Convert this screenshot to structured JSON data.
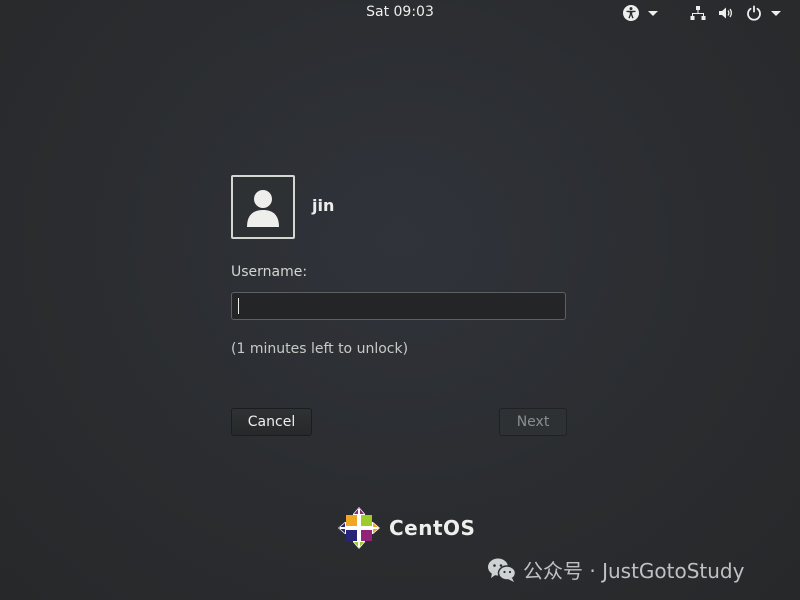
{
  "topbar": {
    "clock": "Sat 09:03",
    "icons": [
      "accessibility-icon",
      "network-icon",
      "volume-icon",
      "power-icon"
    ]
  },
  "login": {
    "user_name": "jin",
    "username_label": "Username:",
    "username_value": "",
    "lock_message": "(1 minutes left to unlock)",
    "cancel_label": "Cancel",
    "next_label": "Next"
  },
  "branding": {
    "logo_text": "CentOS"
  },
  "watermark": {
    "text": "公众号 · JustGotoStudy"
  },
  "colors": {
    "background": "#2b2e30",
    "text": "#eeeeec",
    "disabled_text": "#8b8e8f"
  }
}
